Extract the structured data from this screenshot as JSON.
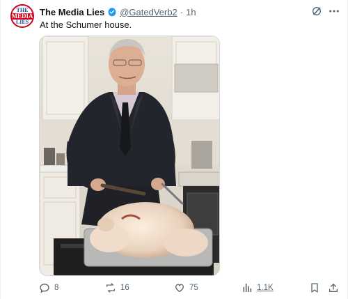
{
  "tweet": {
    "avatar_text": [
      "THE",
      "MEDIA",
      "LIES"
    ],
    "display_name": "The Media Lies",
    "verified": true,
    "handle": "@GatedVerb2",
    "separator": "·",
    "time": "1h",
    "text": "At the Schumer house.",
    "media_description": "photo",
    "actions": {
      "replies": "8",
      "reposts": "16",
      "likes": "75",
      "views": "1.1K"
    }
  },
  "colors": {
    "verified_badge": "#1d9bf0",
    "secondary_text": "#536471",
    "primary_text": "#0f1419",
    "avatar_red": "#d0021b",
    "avatar_blue": "#1d4aa0"
  },
  "icons": [
    "verified-badge-icon",
    "grok-icon",
    "more-icon",
    "reply-icon",
    "repost-icon",
    "like-icon",
    "views-icon",
    "bookmark-icon",
    "share-icon"
  ]
}
